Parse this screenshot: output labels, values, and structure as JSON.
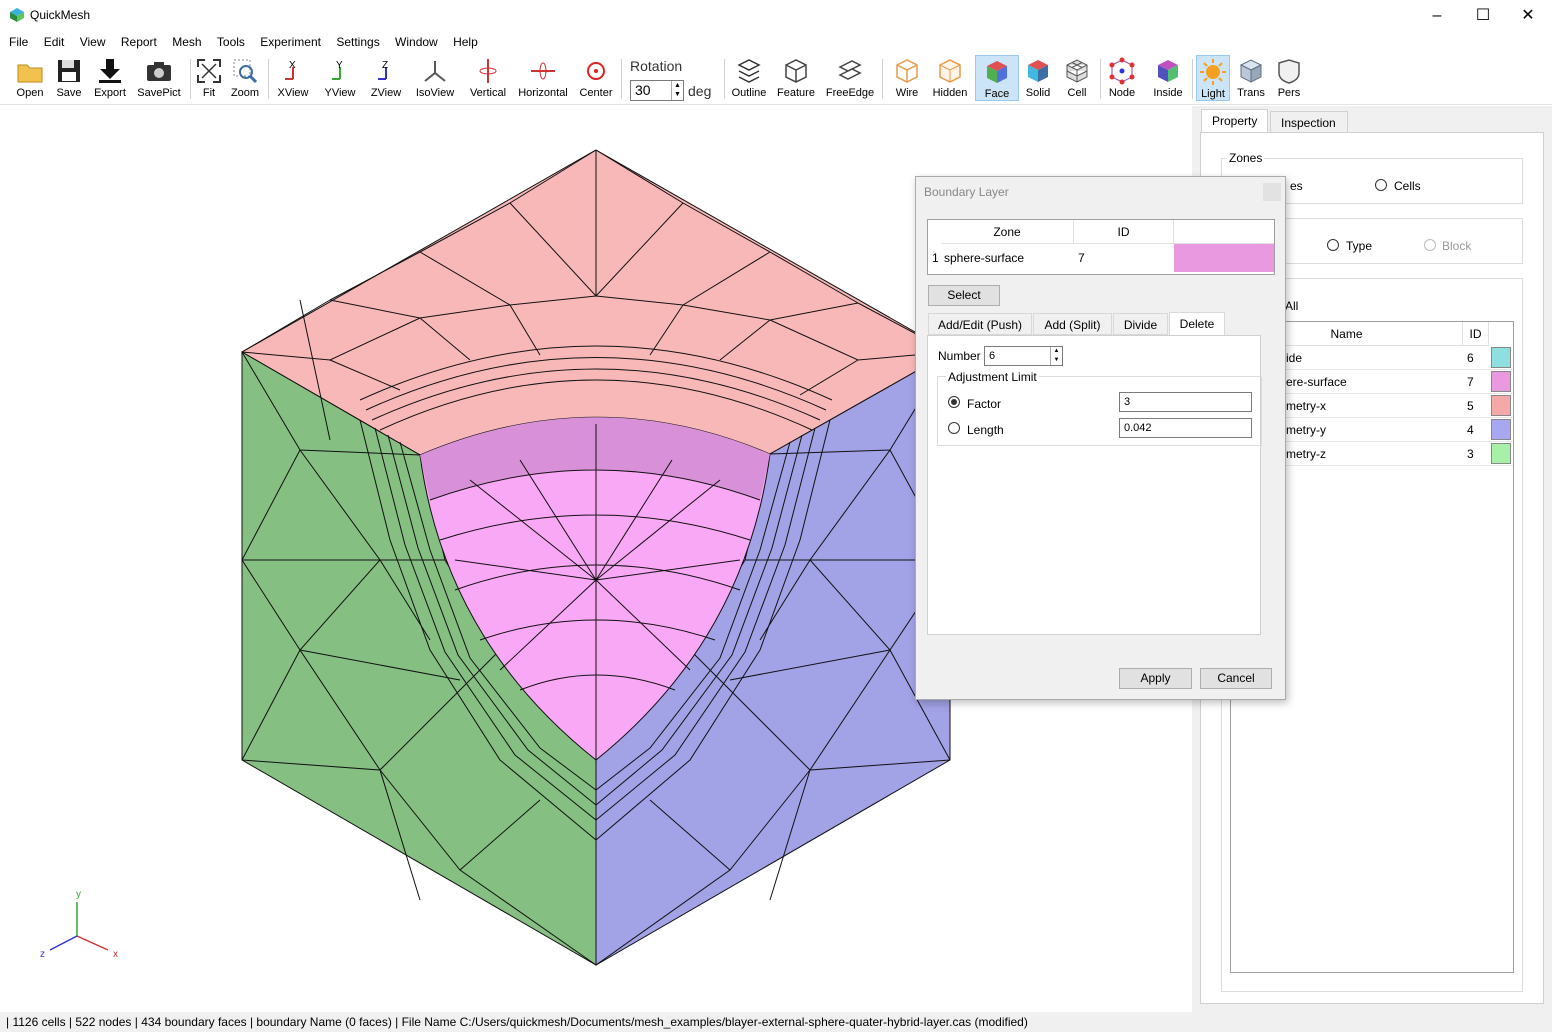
{
  "window": {
    "title": "QuickMesh"
  },
  "menu": [
    "File",
    "Edit",
    "View",
    "Report",
    "Mesh",
    "Tools",
    "Experiment",
    "Settings",
    "Window",
    "Help"
  ],
  "toolbar": {
    "buttons": [
      "Open",
      "Save",
      "Export",
      "SavePict",
      "Fit",
      "Zoom",
      "XView",
      "YView",
      "ZView",
      "IsoView",
      "Vertical",
      "Horizontal",
      "Center",
      "Outline",
      "Feature",
      "FreeEdge",
      "Wire",
      "Hidden",
      "Face",
      "Solid",
      "Cell",
      "Node",
      "Inside",
      "Light",
      "Trans",
      "Pers"
    ],
    "rotation_label": "Rotation",
    "rotation_value": "30",
    "rotation_unit": "deg",
    "active": [
      "Face",
      "Light"
    ]
  },
  "right_panel": {
    "tabs": [
      "Property",
      "Inspection"
    ],
    "zones_label": "Zones",
    "radio_faces_partial": "es",
    "radio_cells": "Cells",
    "radio_type": "Type",
    "radio_block": "Block",
    "all_label": "All",
    "table_headers": [
      "Name",
      "ID"
    ],
    "rows": [
      {
        "name": "ide",
        "id": "6",
        "color": "#8ee0e0"
      },
      {
        "name": "ere-surface",
        "id": "7",
        "color": "#e899e0"
      },
      {
        "name": "metry-x",
        "id": "5",
        "color": "#f4a8a8"
      },
      {
        "name": "metry-y",
        "id": "4",
        "color": "#a8a8f0"
      },
      {
        "name": "metry-z",
        "id": "3",
        "color": "#a8f0a8"
      }
    ]
  },
  "dialog": {
    "title": "Boundary Layer",
    "table_headers": [
      "Zone",
      "ID"
    ],
    "row": {
      "index": "1",
      "zone": "sphere-surface",
      "id": "7",
      "color": "#e899e0"
    },
    "select_button": "Select",
    "tabs": [
      "Add/Edit (Push)",
      "Add (Split)",
      "Divide",
      "Delete"
    ],
    "active_tab": "Delete",
    "number_label": "Number",
    "number_value": "6",
    "adjustment_label": "Adjustment Limit",
    "factor_label": "Factor",
    "factor_value": "3",
    "length_label": "Length",
    "length_value": "0.042",
    "apply_button": "Apply",
    "cancel_button": "Cancel"
  },
  "axes": {
    "x": "x",
    "y": "y",
    "z": "z"
  },
  "status": "| 1126 cells | 522 nodes | 434 boundary faces |  boundary Name  (0 faces) | File Name C:/Users/quickmesh/Documents/mesh_examples/blayer-external-sphere-quater-hybrid-layer.cas (modified)"
}
